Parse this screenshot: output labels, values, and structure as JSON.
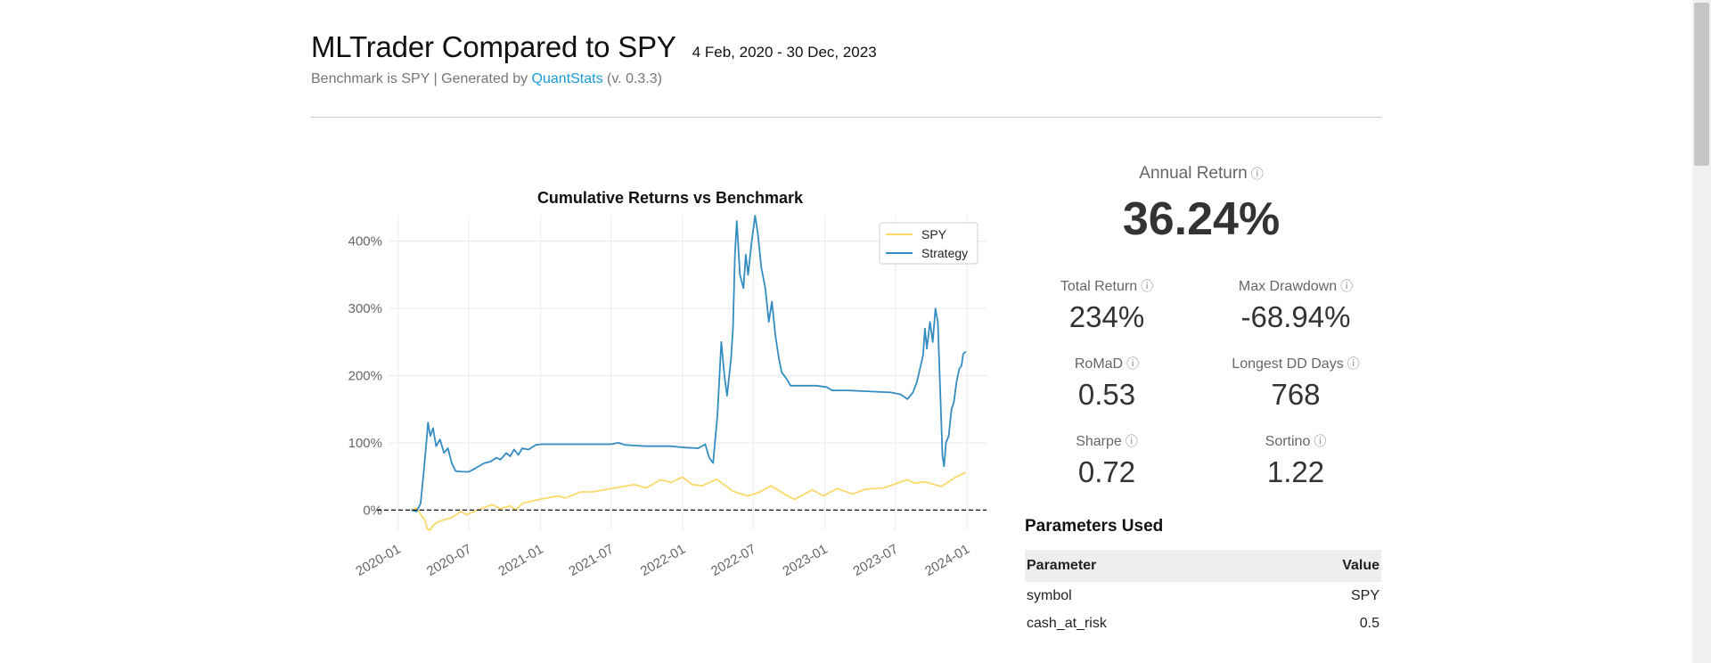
{
  "header": {
    "title": "MLTrader Compared to SPY",
    "date_range": "4 Feb, 2020 - 30 Dec, 2023",
    "subtitle_prefix": "Benchmark is SPY | Generated by",
    "subtitle_link": "QuantStats",
    "subtitle_suffix": "(v. 0.3.3)"
  },
  "colors": {
    "spy": "#fcd96a",
    "strategy": "#348dc1",
    "link": "#1a9bd7"
  },
  "chart_data": {
    "type": "line",
    "title": "Cumulative Returns vs Benchmark",
    "xlabel": "",
    "ylabel": "",
    "ylim": [
      -30,
      438
    ],
    "x_range": [
      "2019-12-10",
      "2024-02-20"
    ],
    "yticks": [
      "0%",
      "100%",
      "200%",
      "300%",
      "400%"
    ],
    "xticks": [
      "2020-01",
      "2020-07",
      "2021-01",
      "2021-07",
      "2022-01",
      "2022-07",
      "2023-01",
      "2023-07",
      "2024-01"
    ],
    "grid": true,
    "legend_position": "top-right",
    "baseline": 0,
    "series": [
      {
        "name": "SPY",
        "color": "#fcd96a",
        "points": [
          [
            "2020-02-04",
            0
          ],
          [
            "2020-02-19",
            3
          ],
          [
            "2020-03-01",
            -8
          ],
          [
            "2020-03-10",
            -15
          ],
          [
            "2020-03-16",
            -28
          ],
          [
            "2020-03-23",
            -30
          ],
          [
            "2020-04-01",
            -22
          ],
          [
            "2020-04-15",
            -17
          ],
          [
            "2020-05-01",
            -14
          ],
          [
            "2020-05-15",
            -12
          ],
          [
            "2020-06-01",
            -6
          ],
          [
            "2020-06-10",
            -2
          ],
          [
            "2020-06-25",
            -7
          ],
          [
            "2020-07-15",
            -2
          ],
          [
            "2020-08-01",
            2
          ],
          [
            "2020-08-30",
            8
          ],
          [
            "2020-09-20",
            2
          ],
          [
            "2020-10-15",
            6
          ],
          [
            "2020-10-30",
            0
          ],
          [
            "2020-11-15",
            10
          ],
          [
            "2020-12-31",
            16
          ],
          [
            "2021-02-15",
            21
          ],
          [
            "2021-03-05",
            18
          ],
          [
            "2021-04-15",
            27
          ],
          [
            "2021-05-15",
            27
          ],
          [
            "2021-07-01",
            32
          ],
          [
            "2021-08-30",
            38
          ],
          [
            "2021-09-30",
            33
          ],
          [
            "2021-11-05",
            45
          ],
          [
            "2021-12-01",
            41
          ],
          [
            "2021-12-31",
            49
          ],
          [
            "2022-01-25",
            38
          ],
          [
            "2022-02-20",
            36
          ],
          [
            "2022-03-29",
            46
          ],
          [
            "2022-05-10",
            28
          ],
          [
            "2022-06-16",
            21
          ],
          [
            "2022-07-15",
            26
          ],
          [
            "2022-08-16",
            36
          ],
          [
            "2022-09-30",
            20
          ],
          [
            "2022-10-15",
            16
          ],
          [
            "2022-11-30",
            30
          ],
          [
            "2022-12-28",
            21
          ],
          [
            "2023-02-02",
            32
          ],
          [
            "2023-03-13",
            24
          ],
          [
            "2023-04-15",
            31
          ],
          [
            "2023-06-01",
            33
          ],
          [
            "2023-07-31",
            45
          ],
          [
            "2023-08-20",
            40
          ],
          [
            "2023-09-15",
            42
          ],
          [
            "2023-10-27",
            35
          ],
          [
            "2023-11-30",
            48
          ],
          [
            "2023-12-29",
            56
          ]
        ]
      },
      {
        "name": "Strategy",
        "color": "#348dc1",
        "points": [
          [
            "2020-02-04",
            0
          ],
          [
            "2020-02-18",
            -2
          ],
          [
            "2020-02-28",
            10
          ],
          [
            "2020-03-06",
            50
          ],
          [
            "2020-03-13",
            95
          ],
          [
            "2020-03-18",
            130
          ],
          [
            "2020-03-24",
            110
          ],
          [
            "2020-03-31",
            122
          ],
          [
            "2020-04-08",
            95
          ],
          [
            "2020-04-18",
            105
          ],
          [
            "2020-04-28",
            85
          ],
          [
            "2020-05-08",
            92
          ],
          [
            "2020-05-18",
            70
          ],
          [
            "2020-05-28",
            58
          ],
          [
            "2020-06-15",
            57
          ],
          [
            "2020-07-01",
            57
          ],
          [
            "2020-07-20",
            63
          ],
          [
            "2020-08-10",
            70
          ],
          [
            "2020-08-25",
            72
          ],
          [
            "2020-09-10",
            78
          ],
          [
            "2020-09-20",
            75
          ],
          [
            "2020-10-05",
            85
          ],
          [
            "2020-10-15",
            80
          ],
          [
            "2020-10-25",
            90
          ],
          [
            "2020-11-05",
            82
          ],
          [
            "2020-11-15",
            92
          ],
          [
            "2020-12-01",
            90
          ],
          [
            "2020-12-20",
            97
          ],
          [
            "2021-01-05",
            98
          ],
          [
            "2021-07-01",
            98
          ],
          [
            "2021-07-20",
            100
          ],
          [
            "2021-08-05",
            97
          ],
          [
            "2021-09-01",
            96
          ],
          [
            "2021-09-30",
            95
          ],
          [
            "2021-10-15",
            95
          ],
          [
            "2021-12-01",
            95
          ],
          [
            "2022-01-05",
            93
          ],
          [
            "2022-02-10",
            92
          ],
          [
            "2022-02-28",
            98
          ],
          [
            "2022-03-10",
            78
          ],
          [
            "2022-03-20",
            70
          ],
          [
            "2022-03-31",
            140
          ],
          [
            "2022-04-10",
            250
          ],
          [
            "2022-04-18",
            200
          ],
          [
            "2022-04-25",
            170
          ],
          [
            "2022-05-05",
            225
          ],
          [
            "2022-05-10",
            270
          ],
          [
            "2022-05-15",
            380
          ],
          [
            "2022-05-20",
            430
          ],
          [
            "2022-05-28",
            350
          ],
          [
            "2022-06-06",
            330
          ],
          [
            "2022-06-12",
            380
          ],
          [
            "2022-06-18",
            350
          ],
          [
            "2022-06-27",
            400
          ],
          [
            "2022-07-06",
            438
          ],
          [
            "2022-07-13",
            410
          ],
          [
            "2022-07-22",
            360
          ],
          [
            "2022-08-01",
            330
          ],
          [
            "2022-08-10",
            280
          ],
          [
            "2022-08-18",
            310
          ],
          [
            "2022-08-27",
            260
          ],
          [
            "2022-09-05",
            225
          ],
          [
            "2022-09-12",
            205
          ],
          [
            "2022-09-25",
            195
          ],
          [
            "2022-10-05",
            185
          ],
          [
            "2022-11-15",
            185
          ],
          [
            "2022-12-10",
            185
          ],
          [
            "2023-01-05",
            183
          ],
          [
            "2023-01-20",
            178
          ],
          [
            "2023-03-01",
            178
          ],
          [
            "2023-06-20",
            175
          ],
          [
            "2023-07-15",
            172
          ],
          [
            "2023-08-01",
            165
          ],
          [
            "2023-08-15",
            175
          ],
          [
            "2023-08-25",
            190
          ],
          [
            "2023-09-10",
            230
          ],
          [
            "2023-09-15",
            270
          ],
          [
            "2023-09-20",
            240
          ],
          [
            "2023-09-28",
            280
          ],
          [
            "2023-10-05",
            250
          ],
          [
            "2023-10-12",
            300
          ],
          [
            "2023-10-18",
            280
          ],
          [
            "2023-10-24",
            180
          ],
          [
            "2023-10-30",
            80
          ],
          [
            "2023-11-03",
            65
          ],
          [
            "2023-11-08",
            100
          ],
          [
            "2023-11-15",
            110
          ],
          [
            "2023-11-22",
            150
          ],
          [
            "2023-11-28",
            160
          ],
          [
            "2023-12-05",
            190
          ],
          [
            "2023-12-12",
            210
          ],
          [
            "2023-12-18",
            215
          ],
          [
            "2023-12-22",
            232
          ],
          [
            "2023-12-29",
            236
          ]
        ]
      }
    ]
  },
  "metrics": {
    "annual_return": {
      "label": "Annual Return",
      "value": "36.24%"
    },
    "info_glyph": "ⓘ",
    "grid": [
      {
        "label": "Total Return",
        "value": "234%"
      },
      {
        "label": "Max Drawdown",
        "value": "-68.94%"
      },
      {
        "label": "RoMaD",
        "value": "0.53"
      },
      {
        "label": "Longest DD Days",
        "value": "768"
      },
      {
        "label": "Sharpe",
        "value": "0.72"
      },
      {
        "label": "Sortino",
        "value": "1.22"
      }
    ]
  },
  "parameters": {
    "title": "Parameters Used",
    "headers": [
      "Parameter",
      "Value"
    ],
    "rows": [
      [
        "symbol",
        "SPY"
      ],
      [
        "cash_at_risk",
        "0.5"
      ]
    ]
  }
}
